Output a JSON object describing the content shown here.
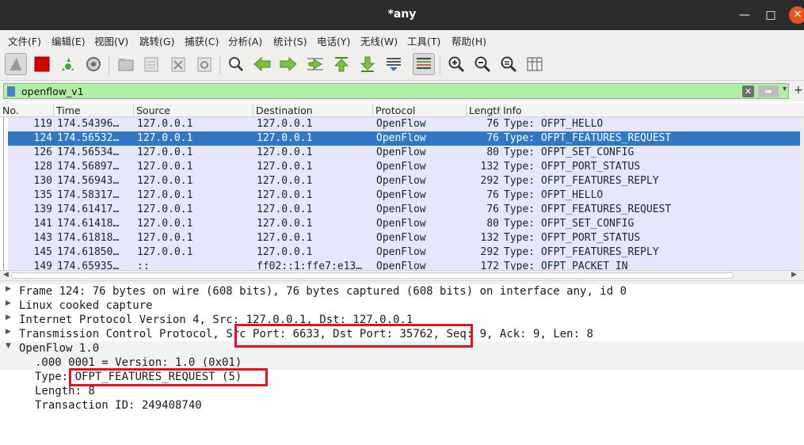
{
  "window": {
    "title": "*any"
  },
  "menu": [
    "文件(F)",
    "编辑(E)",
    "视图(V)",
    "跳转(G)",
    "捕获(C)",
    "分析(A)",
    "统计(S)",
    "电话(Y)",
    "无线(W)",
    "工具(T)",
    "帮助(H)"
  ],
  "toolbar": {
    "icons": [
      "shark-fin-start-icon",
      "stop-capture-icon",
      "restart-capture-icon",
      "capture-options-icon",
      "open-file-icon",
      "save-file-icon",
      "close-file-icon",
      "reload-file-icon",
      "find-packet-icon",
      "go-back-icon",
      "go-forward-icon",
      "go-to-packet-icon",
      "go-first-icon",
      "go-last-icon",
      "autoscroll-icon",
      "colorize-icon",
      "zoom-in-icon",
      "zoom-out-icon",
      "zoom-normal-icon",
      "resize-columns-icon"
    ]
  },
  "filter": {
    "value": "openflow_v1",
    "clear_label": "✕",
    "apply_label": "➡",
    "dropdown_label": "▾",
    "add_label": "+"
  },
  "packet_list": {
    "columns": [
      "No.",
      "Time",
      "Source",
      "Destination",
      "Protocol",
      "Length",
      "Info"
    ],
    "rows": [
      {
        "no": "119",
        "time": "174.54396…",
        "src": "127.0.0.1",
        "dst": "127.0.0.1",
        "proto": "OpenFlow",
        "len": "76",
        "info": "Type: OFPT_HELLO",
        "selected": false
      },
      {
        "no": "124",
        "time": "174.56532…",
        "src": "127.0.0.1",
        "dst": "127.0.0.1",
        "proto": "OpenFlow",
        "len": "76",
        "info": "Type: OFPT_FEATURES_REQUEST",
        "selected": true
      },
      {
        "no": "126",
        "time": "174.56534…",
        "src": "127.0.0.1",
        "dst": "127.0.0.1",
        "proto": "OpenFlow",
        "len": "80",
        "info": "Type: OFPT_SET_CONFIG",
        "selected": false
      },
      {
        "no": "128",
        "time": "174.56897…",
        "src": "127.0.0.1",
        "dst": "127.0.0.1",
        "proto": "OpenFlow",
        "len": "132",
        "info": "Type: OFPT_PORT_STATUS",
        "selected": false
      },
      {
        "no": "130",
        "time": "174.56943…",
        "src": "127.0.0.1",
        "dst": "127.0.0.1",
        "proto": "OpenFlow",
        "len": "292",
        "info": "Type: OFPT_FEATURES_REPLY",
        "selected": false
      },
      {
        "no": "135",
        "time": "174.58317…",
        "src": "127.0.0.1",
        "dst": "127.0.0.1",
        "proto": "OpenFlow",
        "len": "76",
        "info": "Type: OFPT_HELLO",
        "selected": false
      },
      {
        "no": "139",
        "time": "174.61417…",
        "src": "127.0.0.1",
        "dst": "127.0.0.1",
        "proto": "OpenFlow",
        "len": "76",
        "info": "Type: OFPT_FEATURES_REQUEST",
        "selected": false
      },
      {
        "no": "141",
        "time": "174.61418…",
        "src": "127.0.0.1",
        "dst": "127.0.0.1",
        "proto": "OpenFlow",
        "len": "80",
        "info": "Type: OFPT_SET_CONFIG",
        "selected": false
      },
      {
        "no": "143",
        "time": "174.61818…",
        "src": "127.0.0.1",
        "dst": "127.0.0.1",
        "proto": "OpenFlow",
        "len": "132",
        "info": "Type: OFPT_PORT_STATUS",
        "selected": false
      },
      {
        "no": "145",
        "time": "174.61850…",
        "src": "127.0.0.1",
        "dst": "127.0.0.1",
        "proto": "OpenFlow",
        "len": "292",
        "info": "Type: OFPT_FEATURES_REPLY",
        "selected": false
      },
      {
        "no": "149",
        "time": "174.65935…",
        "src": "::",
        "dst": "ff02::1:ffe7:e13…",
        "proto": "OpenFlow",
        "len": "172",
        "info": "Type: OFPT_PACKET_IN",
        "selected": false
      }
    ]
  },
  "details": {
    "frame": "Frame 124: 76 bytes on wire (608 bits), 76 bytes captured (608 bits) on interface any, id 0",
    "linux": "Linux cooked capture",
    "ipv4": "Internet Protocol Version 4, Src: 127.0.0.1, Dst: 127.0.0.1",
    "tcp_prefix": "Transmission Control Protocol,",
    "tcp_ports": "Src Port: 6633, Dst Port: 35762,",
    "tcp_suffix": "Seq: 9, Ack: 9, Len: 8",
    "openflow": "OpenFlow 1.0",
    "version": ".000 0001 = Version: 1.0 (0x01)",
    "type_label": "Type:",
    "type_value": "OFPT_FEATURES_REQUEST (5)",
    "length": "Length: 8",
    "xid": "Transaction ID: 249408740"
  },
  "colors": {
    "row_bg": "#e7e6ff",
    "selected_bg": "#3078c6",
    "filter_bg": "#aff0a4",
    "highlight": "#e0141e"
  }
}
